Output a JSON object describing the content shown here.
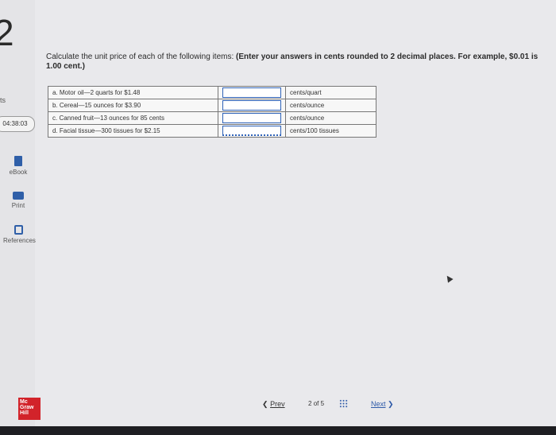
{
  "sidebar": {
    "question_number": "2",
    "points_label": "ts",
    "timer": "04:38:03",
    "tools": [
      {
        "label": "eBook",
        "icon": "book-icon"
      },
      {
        "label": "Print",
        "icon": "printer-icon"
      },
      {
        "label": "References",
        "icon": "references-icon"
      }
    ],
    "logo_lines": [
      "Mc",
      "Graw",
      "Hill"
    ]
  },
  "question": {
    "prompt": "Calculate the unit price of each of the following items: ",
    "instruction": "(Enter your answers in cents rounded to 2 decimal places. For example, $0.01 is 1.00 cent.)"
  },
  "items": [
    {
      "label": "a. Motor oil—2 quarts for $1.48",
      "value": "",
      "unit": "cents/quart"
    },
    {
      "label": "b. Cereal—15 ounces for $3.90",
      "value": "",
      "unit": "cents/ounce"
    },
    {
      "label": "c. Canned fruit—13 ounces for 85 cents",
      "value": "",
      "unit": "cents/ounce"
    },
    {
      "label": "d. Facial tissue—300 tissues for $2.15",
      "value": "",
      "unit": "cents/100 tissues"
    }
  ],
  "navigation": {
    "prev_label": "Prev",
    "page": "2",
    "of_label": "of",
    "total": "5",
    "next_label": "Next"
  }
}
